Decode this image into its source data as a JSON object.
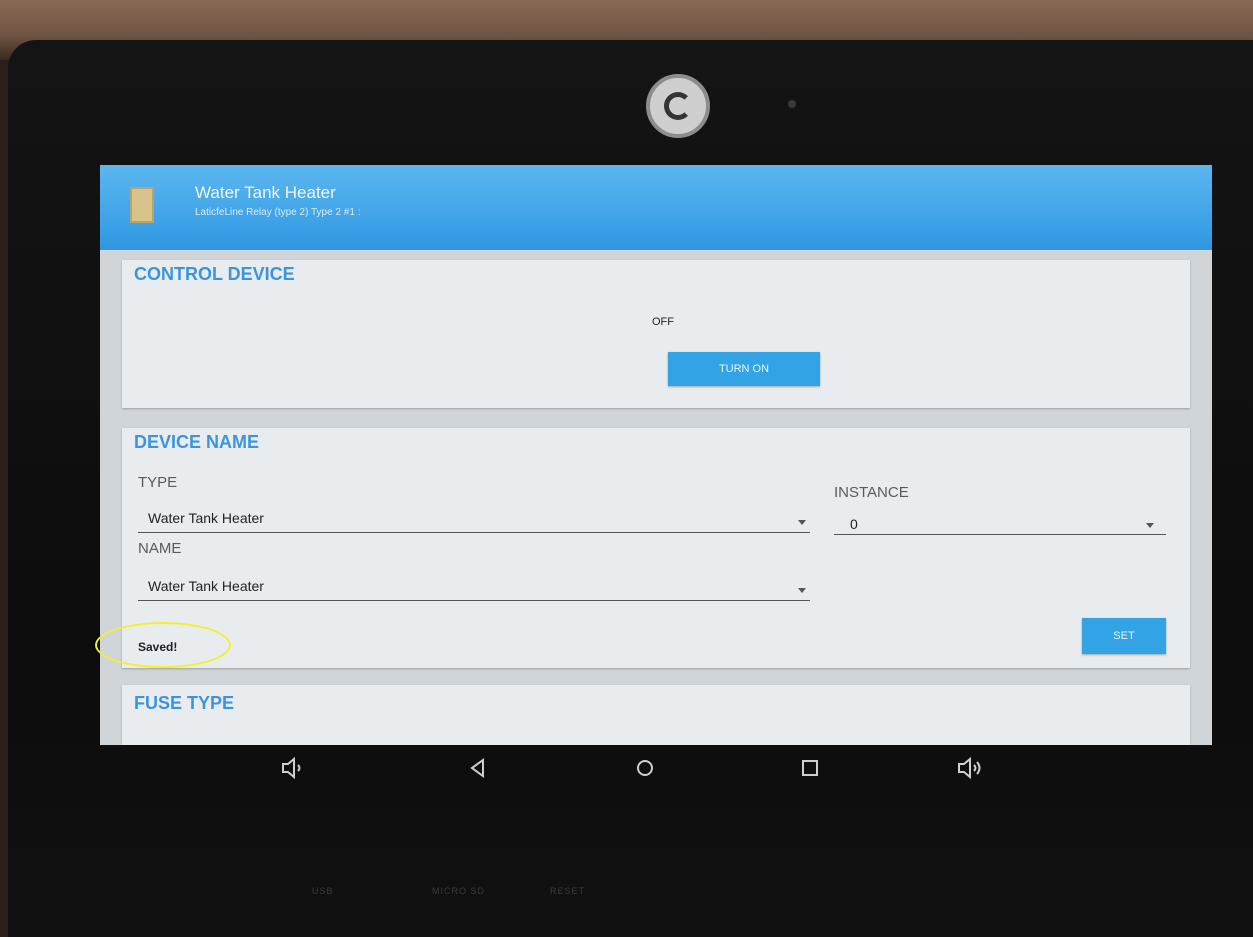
{
  "app": {
    "title": "Water Tank Heater",
    "subtitle": "LaticfeLine Relay (type 2) Type 2 #1 :"
  },
  "control_device": {
    "heading": "CONTROL DEVICE",
    "status": "OFF",
    "turn_on_label": "TURN ON"
  },
  "device_name": {
    "heading": "DEVICE NAME",
    "type_label": "TYPE",
    "type_value": "Water Tank Heater",
    "instance_label": "INSTANCE",
    "instance_value": "0",
    "name_label": "NAME",
    "name_value": "Water Tank Heater",
    "saved_text": "Saved!",
    "set_label": "SET"
  },
  "fuse_type": {
    "heading": "FUSE TYPE"
  },
  "nav": {
    "volume_down": "volume-down-icon",
    "back": "back-icon",
    "home": "home-icon",
    "recents": "recents-icon",
    "volume_up": "volume-up-icon"
  },
  "ports": {
    "usb": "USB",
    "micro_sd": "MICRO SD",
    "reset": "RESET"
  },
  "colors": {
    "appbar": "#2f98e3",
    "accent_heading": "#3c95dc",
    "button": "#32a3e4",
    "highlight_ellipse": "#f2f02a"
  }
}
